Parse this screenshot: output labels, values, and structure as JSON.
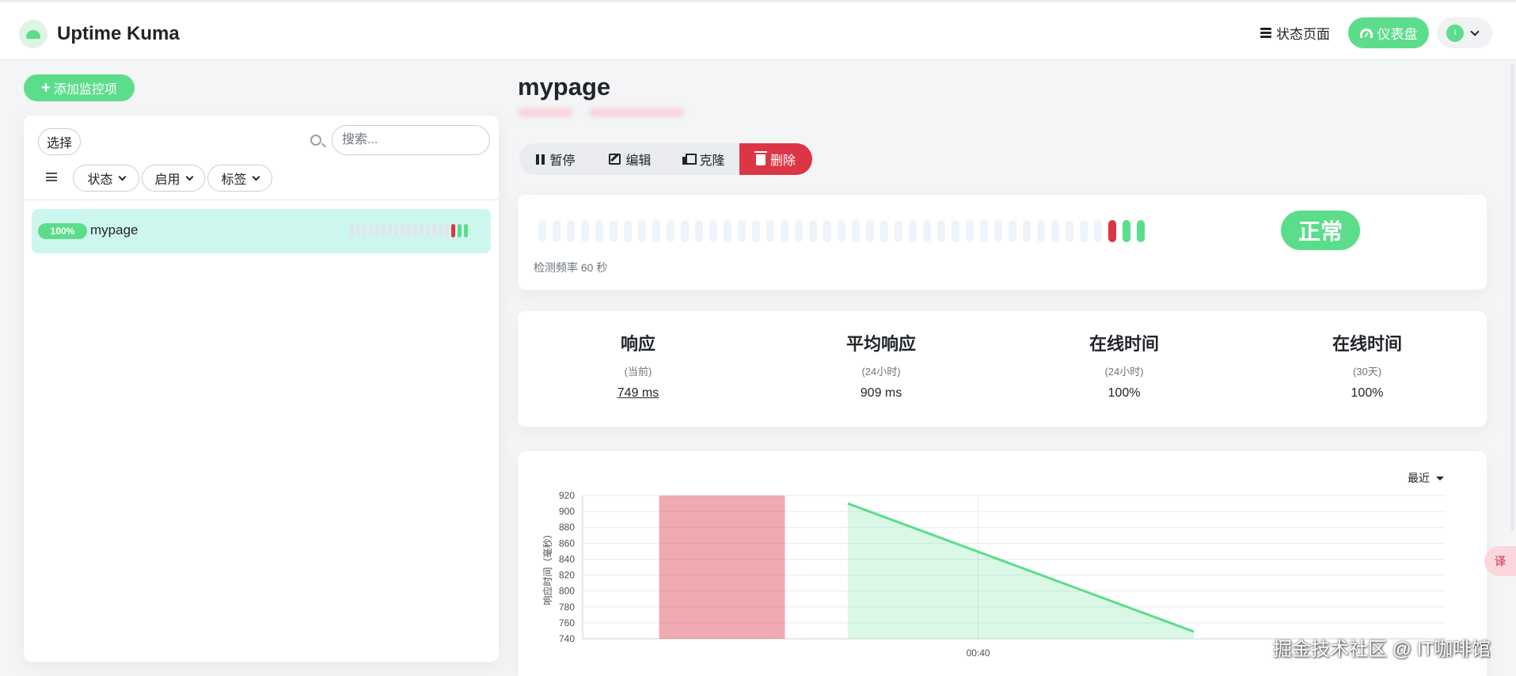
{
  "header": {
    "app_title": "Uptime Kuma",
    "status_page_label": "状态页面",
    "dashboard_label": "仪表盘",
    "avatar_initial": "I"
  },
  "sidebar": {
    "add_monitor_label": "添加监控项",
    "select_label": "选择",
    "search_placeholder": "搜索...",
    "filters": [
      {
        "label": "状态"
      },
      {
        "label": "启用"
      },
      {
        "label": "标签"
      }
    ],
    "monitors": [
      {
        "uptime": "100%",
        "name": "mypage",
        "beats": [
          "empty",
          "empty",
          "empty",
          "empty",
          "empty",
          "empty",
          "empty",
          "empty",
          "empty",
          "empty",
          "empty",
          "empty",
          "empty",
          "empty",
          "empty",
          "empty",
          "down",
          "up",
          "up"
        ]
      }
    ]
  },
  "main": {
    "title": "mypage",
    "actions": {
      "pause": "暂停",
      "edit": "编辑",
      "clone": "克隆",
      "delete": "删除"
    },
    "heartbeat": {
      "beats": [
        "empty",
        "empty",
        "empty",
        "empty",
        "empty",
        "empty",
        "empty",
        "empty",
        "empty",
        "empty",
        "empty",
        "empty",
        "empty",
        "empty",
        "empty",
        "empty",
        "empty",
        "empty",
        "empty",
        "empty",
        "empty",
        "empty",
        "empty",
        "empty",
        "empty",
        "empty",
        "empty",
        "empty",
        "empty",
        "empty",
        "empty",
        "empty",
        "empty",
        "empty",
        "empty",
        "empty",
        "empty",
        "empty",
        "empty",
        "empty",
        "down",
        "up",
        "up"
      ],
      "status": "正常",
      "check_interval": "检测频率 60 秒"
    },
    "stats": [
      {
        "title": "响应",
        "sub": "(当前)",
        "value": "749 ms",
        "link": true
      },
      {
        "title": "平均响应",
        "sub": "(24小时)",
        "value": "909 ms",
        "link": false
      },
      {
        "title": "在线时间",
        "sub": "(24小时)",
        "value": "100%",
        "link": false
      },
      {
        "title": "在线时间",
        "sub": "(30天)",
        "value": "100%",
        "link": false
      }
    ],
    "range_label": "最近"
  },
  "colors": {
    "accent": "#5cdd8b",
    "danger": "#dc3545",
    "selected_row": "#cdf7ee"
  },
  "chart_data": {
    "type": "area",
    "ylabel": "响应时间（毫秒）",
    "xlabel": "",
    "ylim": [
      740,
      920
    ],
    "yticks": [
      920,
      900,
      880,
      860,
      840,
      820,
      800,
      780,
      760,
      740
    ],
    "xlim_minutes": [
      -0.88,
      1.04
    ],
    "x_tick_labels": [
      {
        "label": "00:40",
        "at_minutes": 0
      }
    ],
    "down_regions_minutes": [
      [
        -0.71,
        -0.43
      ]
    ],
    "series": [
      {
        "x_minutes": [
          -0.29,
          0.48
        ],
        "values": [
          910,
          749
        ]
      }
    ],
    "grid": true
  },
  "watermark": "掘金技术社区 @ IT咖啡馆",
  "translate_icon": "译"
}
